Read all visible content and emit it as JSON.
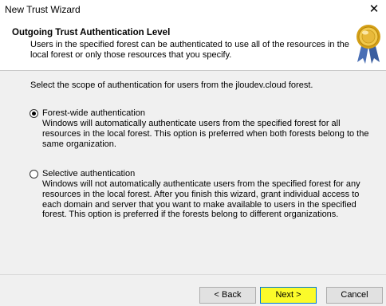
{
  "window": {
    "title": "New Trust Wizard",
    "close_glyph": "✕"
  },
  "header": {
    "heading": "Outgoing Trust Authentication Level",
    "description": "Users in the specified forest can be authenticated to use all of the resources in the local forest or only those resources that you specify.",
    "icon": "certificate-seal-icon"
  },
  "content": {
    "scope_text": "Select the scope of authentication for users from the jloudev.cloud forest.",
    "options": [
      {
        "label": "Forest-wide authentication",
        "description": "Windows will automatically authenticate users from the specified forest for all resources in the local forest. This option is preferred when both forests belong to the same organization.",
        "selected": true
      },
      {
        "label": "Selective authentication",
        "description": "Windows will not automatically authenticate users from the specified forest for any resources in the local forest. After you finish this wizard, grant individual access to each domain and server that you want to make available to users in the specified forest. This option is preferred if the forests belong to different organizations.",
        "selected": false
      }
    ]
  },
  "buttons": {
    "back": "< Back",
    "next": "Next >",
    "cancel": "Cancel"
  },
  "colors": {
    "next_highlight": "#fbfb2a",
    "dialog_bg": "#f0f0f0",
    "focus_border": "#0078d7"
  }
}
